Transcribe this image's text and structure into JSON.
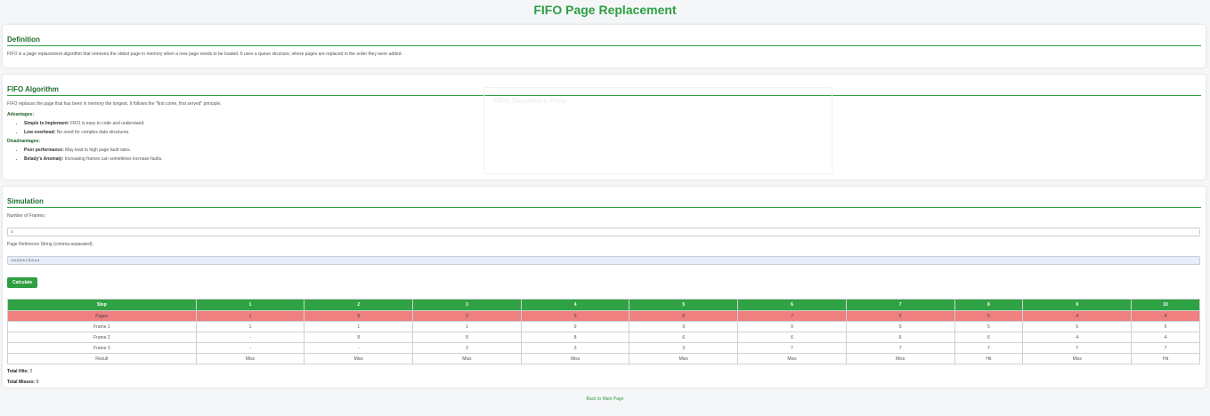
{
  "page_title": "FIFO Page Replacement",
  "definition": {
    "heading": "Definition",
    "text": "FIFO is a page replacement algorithm that removes the oldest page in memory when a new page needs to be loaded. It uses a queue structure, where pages are replaced in the order they were added."
  },
  "algorithm": {
    "heading": "FIFO Algorithm",
    "intro": "FIFO replaces the page that has been in memory the longest. It follows the \"first come, first served\" principle.",
    "advantages_heading": "Advantages:",
    "advantages": [
      {
        "term": "Simple to Implement:",
        "desc": " FIFO is easy to code and understand."
      },
      {
        "term": "Low overhead:",
        "desc": " No need for complex data structures."
      }
    ],
    "disadvantages_heading": "Disadvantages:",
    "disadvantages": [
      {
        "term": "Poor performance:",
        "desc": " May lead to high page fault rates."
      },
      {
        "term": "Belady's Anomaly:",
        "desc": " Increasing frames can sometimes increase faults."
      }
    ],
    "ghost_panel_text": "FIFO Simulation Flow"
  },
  "simulation": {
    "heading": "Simulation",
    "frames_label": "Number of Frames:",
    "frames_value": "3",
    "ref_label": "Page Reference String (comma-separated):",
    "ref_value": "1,8,3,9,6,7,5,6,4,4",
    "calculate_label": "Calculate",
    "table": {
      "header": [
        "Step",
        "1",
        "2",
        "3",
        "4",
        "5",
        "6",
        "7",
        "8",
        "9",
        "10"
      ],
      "rows": [
        [
          "Pages",
          "1",
          "8",
          "3",
          "9",
          "6",
          "7",
          "5",
          "6",
          "4",
          "4"
        ],
        [
          "Frame 1",
          "1",
          "1",
          "1",
          "9",
          "9",
          "9",
          "5",
          "5",
          "5",
          "5"
        ],
        [
          "Frame 2",
          "-",
          "8",
          "8",
          "8",
          "6",
          "6",
          "6",
          "6",
          "4",
          "4"
        ],
        [
          "Frame 3",
          "-",
          "-",
          "3",
          "3",
          "3",
          "7",
          "7",
          "7",
          "7",
          "7"
        ],
        [
          "Result",
          "Miss",
          "Miss",
          "Miss",
          "Miss",
          "Miss",
          "Miss",
          "Miss",
          "Hit",
          "Miss",
          "Hit"
        ]
      ]
    },
    "total_hits_label": "Total Hits:",
    "total_hits": "2",
    "total_misses_label": "Total Misses:",
    "total_misses": "8"
  },
  "footer_link": "Back to Main Page"
}
